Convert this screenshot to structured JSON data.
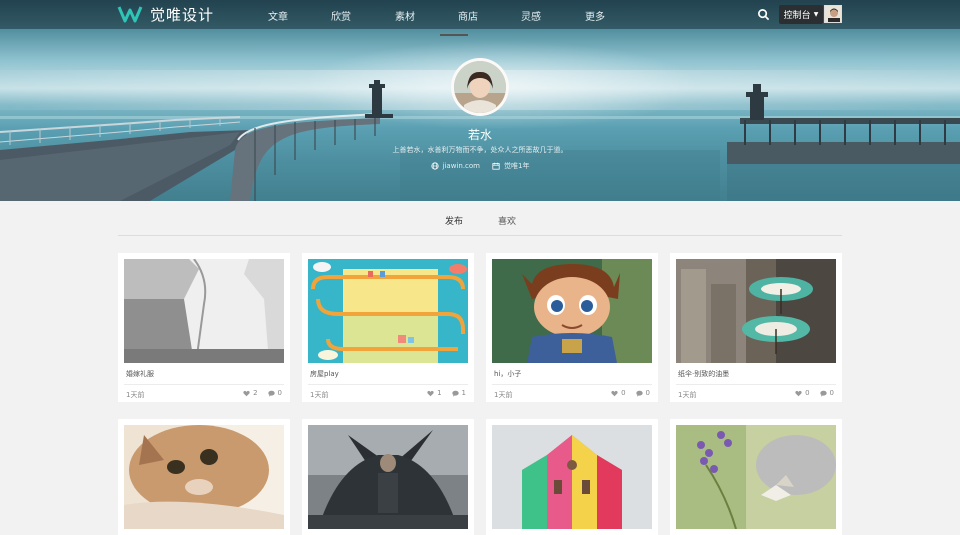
{
  "brand": {
    "name": "觉唯设计"
  },
  "nav": {
    "items": [
      "文章",
      "欣赏",
      "素材",
      "商店",
      "灵感",
      "更多"
    ]
  },
  "header": {
    "console_label": "控制台"
  },
  "profile": {
    "name": "若水",
    "bio": "上善若水，水善利万物而不争，处众人之所恶故几于道。",
    "website": "jiawin.com",
    "joined": "觉唯1年"
  },
  "tabs": [
    "发布",
    "喜欢"
  ],
  "cards": [
    {
      "title": "婚嫁礼服",
      "time": "1天前",
      "likes": "2",
      "comments": "0"
    },
    {
      "title": "房屋play",
      "time": "1天前",
      "likes": "1",
      "comments": "1"
    },
    {
      "title": "hi，小子",
      "time": "1天前",
      "likes": "0",
      "comments": "0"
    },
    {
      "title": "纸伞·别致的油墨",
      "time": "1天前",
      "likes": "0",
      "comments": "0"
    },
    {
      "title": "",
      "time": "",
      "likes": "",
      "comments": ""
    },
    {
      "title": "",
      "time": "",
      "likes": "",
      "comments": ""
    },
    {
      "title": "",
      "time": "",
      "likes": "",
      "comments": ""
    },
    {
      "title": "",
      "time": "",
      "likes": "",
      "comments": ""
    }
  ],
  "colors": {
    "accent": "#2ec4b6",
    "nav_bg": "#1c3038",
    "page_bg": "#f2f2f2"
  }
}
